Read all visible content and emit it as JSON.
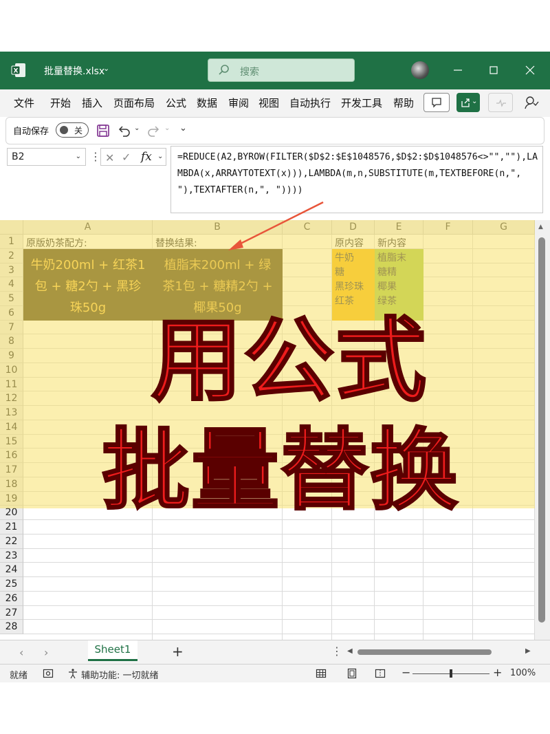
{
  "window": {
    "filename": "批量替换.xlsx",
    "search_placeholder": "搜索"
  },
  "ribbon": {
    "tabs": [
      "文件",
      "开始",
      "插入",
      "页面布局",
      "公式",
      "数据",
      "审阅",
      "视图",
      "自动执行",
      "开发工具",
      "帮助"
    ]
  },
  "quick_access": {
    "autosave_label": "自动保存",
    "autosave_state": "关"
  },
  "formula_bar": {
    "name_box": "B2",
    "fx_label": "fx",
    "formula": "=REDUCE(A2,BYROW(FILTER($D$2:$E$1048576,$D$2:$D$1048576<>\"\",\"\"),LAMBDA(x,ARRAYTOTEXT(x))),LAMBDA(m,n,SUBSTITUTE(m,TEXTBEFORE(n,\", \"),TEXTAFTER(n,\", \"))))"
  },
  "grid": {
    "columns": [
      "A",
      "B",
      "C",
      "D",
      "E",
      "F",
      "G"
    ],
    "rows": [
      "1",
      "2",
      "3",
      "4",
      "5",
      "6",
      "7",
      "8",
      "9",
      "10",
      "11",
      "12",
      "13",
      "14",
      "15",
      "16",
      "17",
      "18",
      "19",
      "20",
      "21",
      "22",
      "23",
      "24",
      "25",
      "26",
      "27",
      "28"
    ],
    "cells": {
      "A1": "原版奶茶配方:",
      "B1": "替换结果:",
      "D1": "原内容",
      "E1": "新内容",
      "A2_lines": [
        "牛奶200ml + 红茶1",
        "包 + 糖2勺 + 黑珍",
        "珠50g"
      ],
      "B2_lines": [
        "植脂末200ml + 绿",
        "茶1包 + 糖精2勺 +",
        "椰果50g"
      ],
      "D_values": [
        "牛奶",
        "糖",
        "黑珍珠",
        "红茶"
      ],
      "E_values": [
        "植脂末",
        "糖精",
        "椰果",
        "绿茶"
      ]
    },
    "overlay_line1": "用公式",
    "overlay_line2": "批量替换"
  },
  "sheets": {
    "active": "Sheet1",
    "add_label": "+"
  },
  "status": {
    "ready": "就绪",
    "accessibility": "辅助功能: 一切就绪",
    "zoom_minus": "−",
    "zoom_plus": "+",
    "zoom": "100%"
  },
  "colors": {
    "excel_green": "#1f7145",
    "highlight_yellow": "#f8e26e",
    "dark_cell": "#4a3b0c",
    "orange_cell": "#f7b500",
    "green_cell": "#a7c83c",
    "overlay_red": "#ee1c1c",
    "arrow": "#e8553a"
  }
}
